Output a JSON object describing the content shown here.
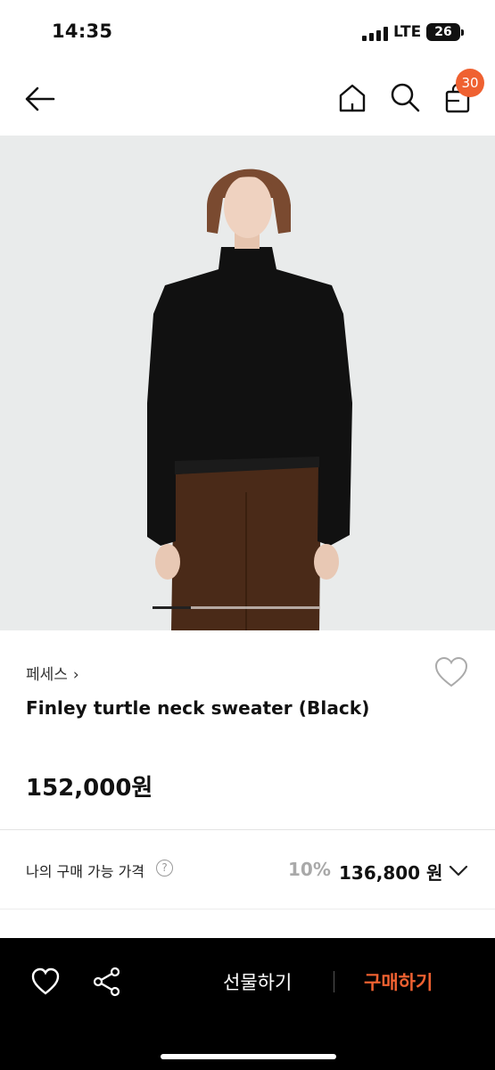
{
  "status_bar": {
    "time": "14:35",
    "network": "LTE",
    "battery": "26"
  },
  "nav": {
    "cart_count": "30",
    "icons": [
      "back-arrow-icon",
      "home-icon",
      "search-icon",
      "shopping-bag-icon"
    ]
  },
  "gallery": {
    "progress": 0.23
  },
  "product": {
    "brand": "페세스",
    "brand_chevron": "›",
    "title": "Finley turtle neck sweater (Black)",
    "price": "152,000원"
  },
  "member_price": {
    "label": "나의 구매 가능 가격",
    "help": "?",
    "discount": "10%",
    "price": "136,800 원"
  },
  "bottom_bar": {
    "gift_label": "선물하기",
    "buy_label": "구매하기"
  },
  "colors": {
    "accent": "#ef6131",
    "bottom_bar": "#000000",
    "image_bg": "#e9ebeb"
  }
}
